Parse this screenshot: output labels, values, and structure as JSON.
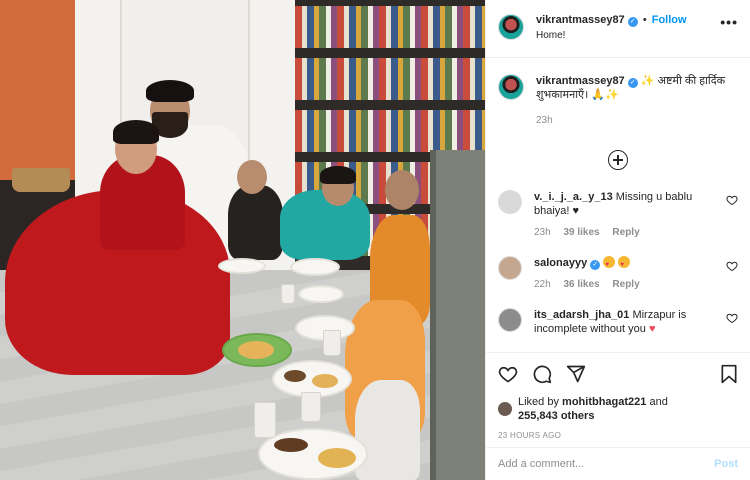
{
  "post": {
    "photo": {
      "icon": "family-puja-photo"
    },
    "header": {
      "username": "vikrantmassey87",
      "separator": "•",
      "follow_label": "Follow",
      "location": "Home!",
      "more_label": "•••"
    },
    "caption": {
      "username": "vikrantmassey87",
      "text": "✨ अष्टमी की हार्दिक शुभकामनाएँ। 🙏✨",
      "time": "23h"
    },
    "comments": [
      {
        "username": "v._i._j._a._y_13",
        "text": "Missing u bablu bhaiya! ♥",
        "time": "23h",
        "likes": "39 likes",
        "reply": "Reply",
        "avatar_color": "#d9d9d9"
      },
      {
        "username": "salonayyy",
        "text": "",
        "time": "22h",
        "likes": "36 likes",
        "reply": "Reply",
        "avatar_color": "#c5a78f"
      },
      {
        "username": "its_adarsh_jha_01",
        "text": "Mirzapur is incomplete without you",
        "time": "",
        "likes": "",
        "reply": "",
        "avatar_color": "#8c8c8c"
      }
    ],
    "likes": {
      "prefix": "Liked by",
      "user": "mohitbhagat221",
      "and": "and",
      "count": "255,843 others"
    },
    "timestamp": "23 HOURS AGO",
    "add_comment": {
      "placeholder": "Add a comment...",
      "post_label": "Post"
    },
    "colors": {
      "accent": "#0095f6",
      "verified": "#3897f0",
      "muted": "#8e8e8e",
      "heart": "#ed4956"
    }
  }
}
